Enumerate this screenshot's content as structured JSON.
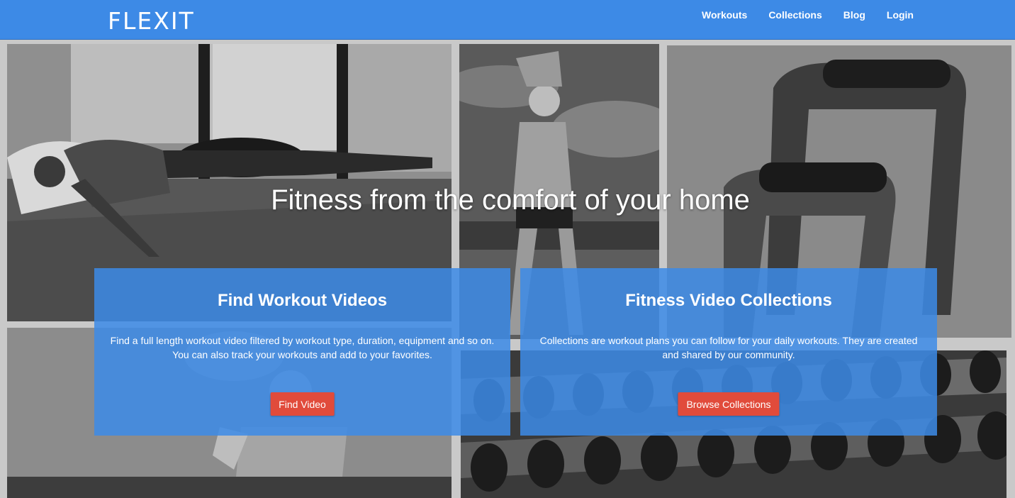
{
  "brand": {
    "logo": "FLEXIT"
  },
  "nav": {
    "links": [
      {
        "label": "Workouts"
      },
      {
        "label": "Collections"
      },
      {
        "label": "Blog"
      },
      {
        "label": "Login"
      }
    ]
  },
  "hero": {
    "title": "Fitness from the comfort of your home",
    "cards": [
      {
        "title": "Find Workout Videos",
        "text": "Find a full length workout video filtered by workout type, duration, equipment and so on. You can also track your workouts and add to your favorites.",
        "button": "Find Video"
      },
      {
        "title": "Fitness Video Collections",
        "text": "Collections are workout plans you can follow for your daily workouts. They are created and shared by our community.",
        "button": "Browse Collections"
      }
    ]
  },
  "colors": {
    "navbar": "#3d8ae6",
    "card_overlay": "rgba(61,138,230,0.86)",
    "button": "#e14b3b",
    "text": "#ffffff"
  },
  "images": [
    "man doing plank push-up in loft",
    "woman stretching outdoors",
    "push-up bars",
    "woman running outdoors",
    "rack of dumbbells"
  ]
}
